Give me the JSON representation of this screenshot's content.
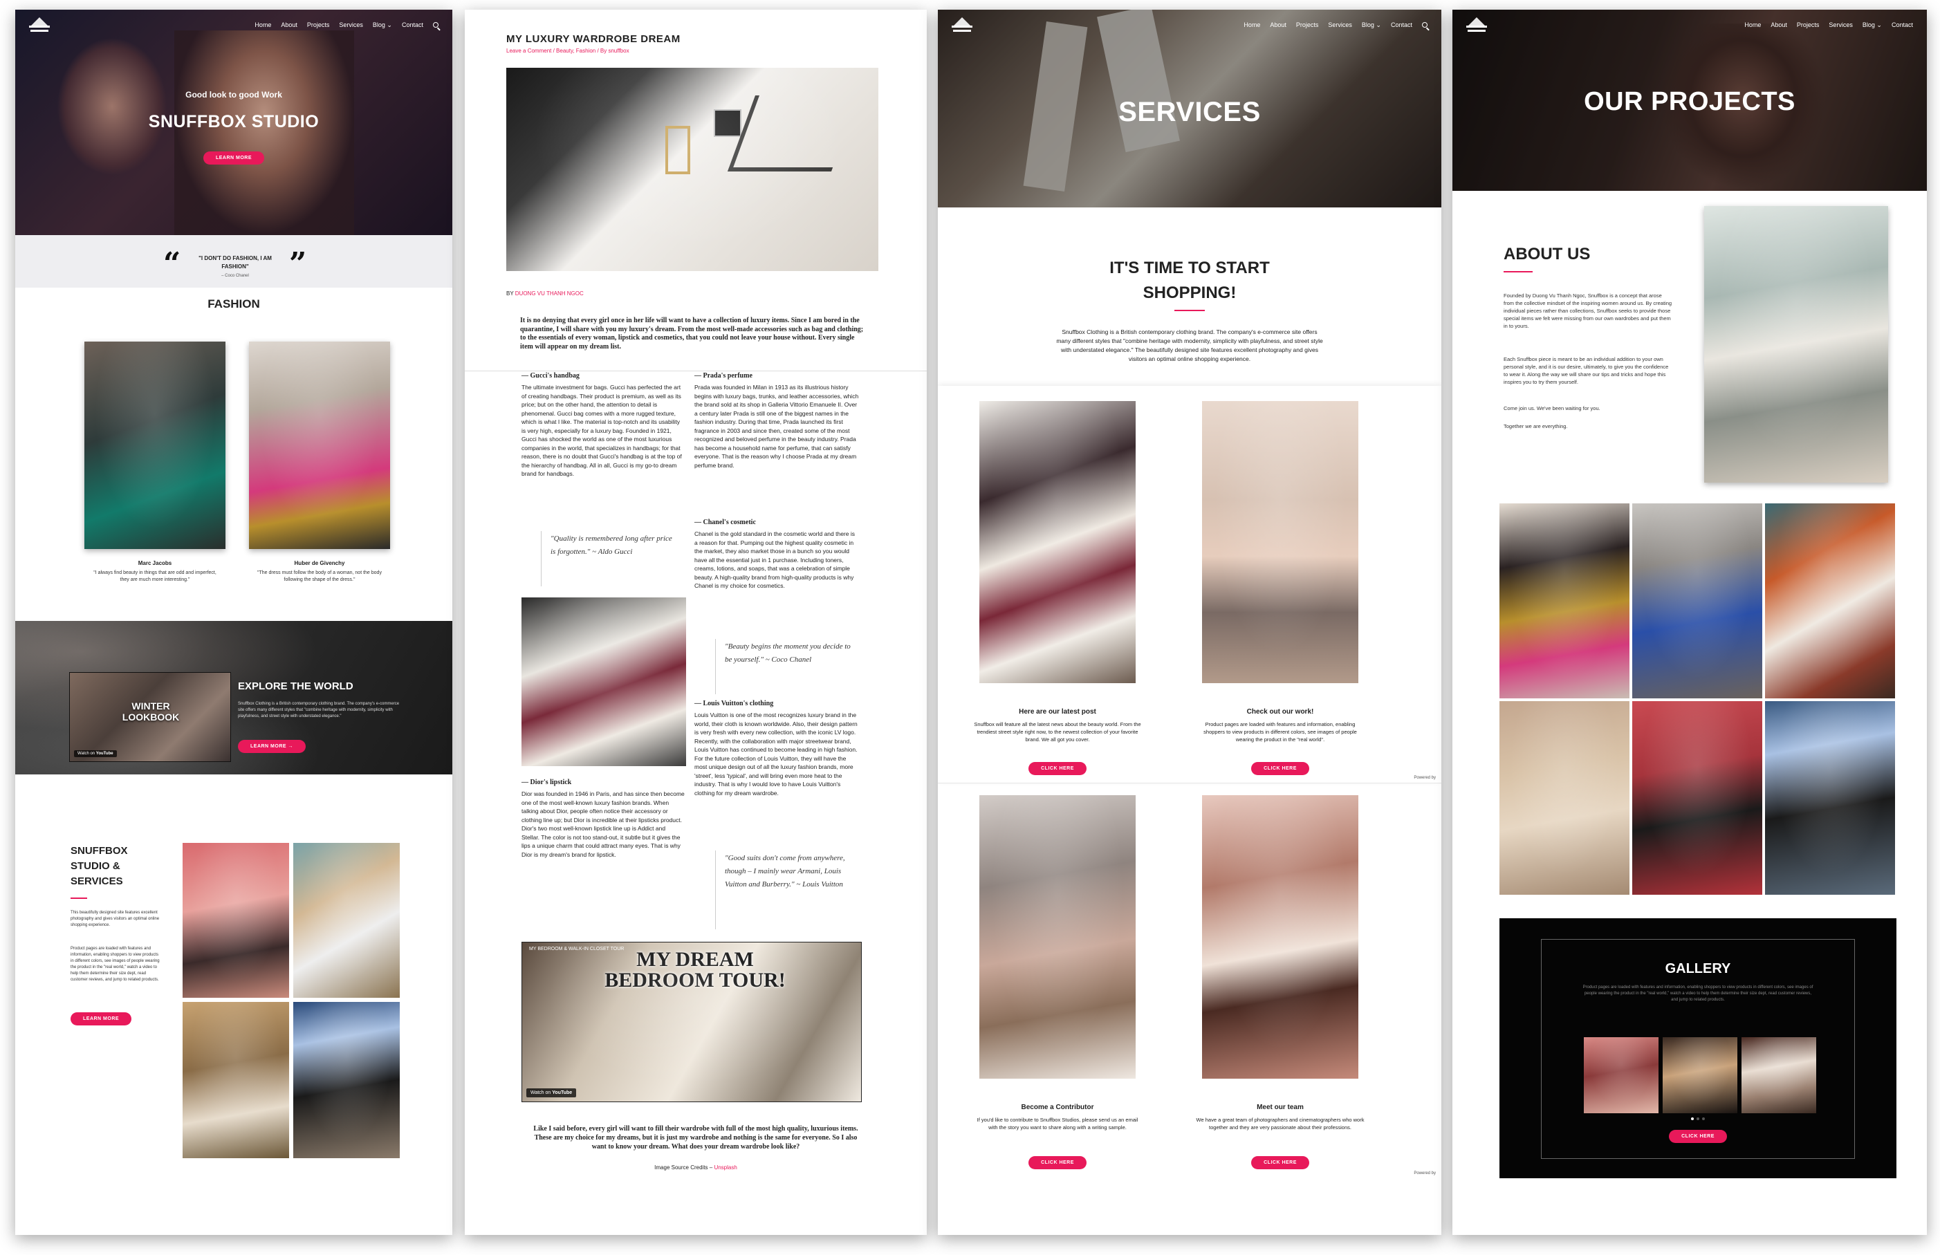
{
  "nav": {
    "items_short": [
      "Home",
      "About",
      "Projects",
      "Services",
      "Blog",
      "Contact"
    ]
  },
  "p1": {
    "hero_sub": "Good look to good Work",
    "hero_title": "SNUFFBOX STUDIO",
    "hero_button": "LEARN MORE",
    "quote": "\"I DON'T DO FASHION, I AM FASHION\"",
    "quote_author": "– Coco Chanel",
    "fashion_title": "FASHION",
    "cards": [
      {
        "name": "Marc Jacobs",
        "text": "\"I always find beauty in things that are odd and imperfect, they are much more interesting.\""
      },
      {
        "name": "Huber de Givenchy",
        "text": "\"The dress must follow the body of a woman, not the body following the shape of the dress.\""
      }
    ],
    "video_title": "WINTER LOOKBOOK",
    "video_watch": "Watch on",
    "video_brand": "YouTube",
    "explore_title": "EXPLORE THE WORLD",
    "explore_text": "Snuffbox Clothing is a British contemporary clothing brand. The company's e-commerce site offers many different styles that \"combine heritage with modernity, simplicity with playfulness, and street style with understated elegance.\"",
    "explore_button": "LEARN MORE →",
    "studio_title": "SNUFFBOX STUDIO & SERVICES",
    "studio_text1": "This beautifully designed site features excellent photography and gives visitors an optimal online shopping experience.",
    "studio_text2": "Product pages are loaded with features and information, enabling shoppers to view products in different colors, see images of people wearing the product in the \"real world,\" watch a video to help them determine their size dept, read customer reviews, and jump to related products.",
    "studio_button": "LEARN MORE"
  },
  "p2": {
    "title": "MY LUXURY WARDROBE DREAM",
    "meta": "Leave a Comment / Beauty, Fashion / By snuffbox",
    "by_label": "BY",
    "by_name": "DUONG VU THANH NGOC",
    "intro": "It is no denying that every girl once in her life will want to have a collection of luxury items. Since I am bored in the quarantine, I will share with you my luxury's dream. From the most well-made accessories such as bag and clothing; to the essentials of every woman, lipstick and cosmetics, that you could not leave your house without. Every single item will appear on my dream list.",
    "h_gucci": "— Gucci's handbag",
    "t_gucci": "The ultimate investment for bags. Gucci has perfected the art of creating handbags. Their product is premium, as well as its price; but on the other hand, the attention to detail is phenomenal. Gucci bag comes with a more rugged texture, which is what I like. The material is top-notch and its usability is very high, especially for a luxury bag. Founded in 1921, Gucci has shocked the world as one of the most luxurious companies in the world, that specializes in handbags; for that reason, there is no doubt that Gucci's handbag is at the top of the hierarchy of handbag. All in all, Gucci is my go-to dream brand for handbags.",
    "q_gucci": "\"Quality is remembered long after price is forgotten.\" ~ Aldo Gucci",
    "h_prada": "— Prada's perfume",
    "t_prada": "Prada was founded in Milan in 1913 as its illustrious history begins with luxury bags, trunks, and leather accessories, which the brand sold at its shop in Galleria Vittorio Emanuele II. Over a century later Prada is still one of the biggest names in the fashion industry. During that time, Prada launched its first fragrance in 2003 and since then, created some of the most recognized and beloved perfume in the beauty industry. Prada has become a household name for perfume, that can satisfy everyone. That is the reason why I choose Prada at my dream perfume brand.",
    "h_chanel": "— Chanel's cosmetic",
    "t_chanel": "Chanel is the gold standard in the cosmetic world and there is a reason for that. Pumping out the highest quality cosmetic in the market, they also market those in a bunch so you would have all the essential just in 1 purchase. Including toners, creams, lotions, and soaps, that was a celebration of simple beauty. A high-quality brand from high-quality products is why Chanel is my choice for cosmetics.",
    "q_chanel": "\"Beauty begins the moment you decide to be yourself.\" ~ Coco Chanel",
    "h_lv": "— Louis Vuitton's clothing",
    "t_lv": "Louis Vuitton is one of the most recognizes luxury brand in the world, their cloth is known worldwide. Also, their design pattern is very fresh with every new collection, with the iconic LV logo. Recently, with the collaboration with major streetwear brand, Louis Vuitton has continued to become leading in high fashion. For the future collection of Louis Vuitton, they will have the most unique design out of all the luxury fashion brands, more 'street', less 'typical', and will bring even more heat to the industry. That is why I would love to have Louis Vuitton's clothing for my dream wardrobe.",
    "h_dior": "— Dior's lipstick",
    "t_dior": "Dior was founded in 1946 in Paris, and has since then become one of the most well-known luxury fashion brands. When talking about Dior, people often notice their accessory or clothing line up; but Dior is incredible at their lipsticks product. Dior's two most well-known lipstick line up is Addict and Stellar. The color is not too stand-out, it subtle but it gives the lips a unique charm that could attract many eyes. That is why Dior is my dream's brand for lipstick.",
    "q_armani": "\"Good suits don't come from anywhere, though – I mainly wear Armani, Louis Vuitton and Burberry.\" ~ Louis Vuitton",
    "video_channel": "MY BEDROOM & WALK-IN CLOSET TOUR",
    "video_title": "MY DREAM BEDROOM TOUR!",
    "video_watch": "Watch on",
    "video_brand": "YouTube",
    "outro": "Like I said before, every girl will want to fill their wardrobe with full of the most high quality, luxurious items. These are my choice for my dreams, but it is just my wardrobe and nothing is the same for everyone. So I also want to know your dream. What does your dream wardrobe look like?",
    "credit_label": "Image Source Credits –",
    "credit_link": "Unsplash"
  },
  "p3": {
    "hero_title": "SERVICES",
    "title_line1": "IT'S TIME TO START",
    "title_line2": "SHOPPING!",
    "intro": "Snuffbox Clothing is a British contemporary clothing brand. The company's e-commerce site offers many different styles that \"combine heritage with modernity, simplicity with playfulness, and street style with understated elegance.\" The beautifully designed site features excellent photography and gives visitors an optimal online shopping experience.",
    "cards": [
      {
        "title": "Here are our latest post",
        "text": "Snuffbox will feature all the latest news about the beauty world. From the trendiest street style right now, to the newest collection of your favorite brand. We all got you cover.",
        "button": "CLICK HERE"
      },
      {
        "title": "Check out our work!",
        "text": "Product pages are loaded with features and information, enabling shoppers to view products in different colors, see images of people wearing the product in the \"real world\".",
        "button": "CLICK HERE"
      },
      {
        "title": "Become a Contributor",
        "text": "If you'd like to contribute to Snuffbox Studios, please send us an email with the story you want to share along with a writing sample.",
        "button": "CLICK HERE"
      },
      {
        "title": "Meet our team",
        "text": "We have a great team of photographers and cinematographers who work together and they are very passionate about their professions.",
        "button": "CLICK HERE"
      }
    ],
    "powered": "Powered by"
  },
  "p4": {
    "hero_title": "OUR PROJECTS",
    "about_title": "ABOUT US",
    "about_p1": "Founded by Duong Vu Thanh Ngoc, Snuffbox is a concept that arose from the collective mindset of the inspiring women around us. By creating individual pieces rather than collections, Snuffbox seeks to provide those special items we felt were missing from our own wardrobes and put them in to yours.",
    "about_p2": "Each Snuffbox piece is meant to be an individual addition to your own personal style, and it is our desire, ultimately, to give you the confidence to wear it. Along the way we will share our tips and tricks and hope this inspires you to try them yourself.",
    "about_p3": "Come join us. We've been waiting for you.",
    "about_p4": "Together we are everything.",
    "gallery_title": "GALLERY",
    "gallery_text": "Product pages are loaded with features and information, enabling shoppers to view products in different colors, see images of people wearing the product in the \"real world,\" watch a video to help them determine their size dept, read customer reviews, and jump to related products.",
    "gallery_button": "CLICK HERE"
  },
  "colors": {
    "accent": "#e8195a",
    "dark": "#0a0a0a"
  }
}
